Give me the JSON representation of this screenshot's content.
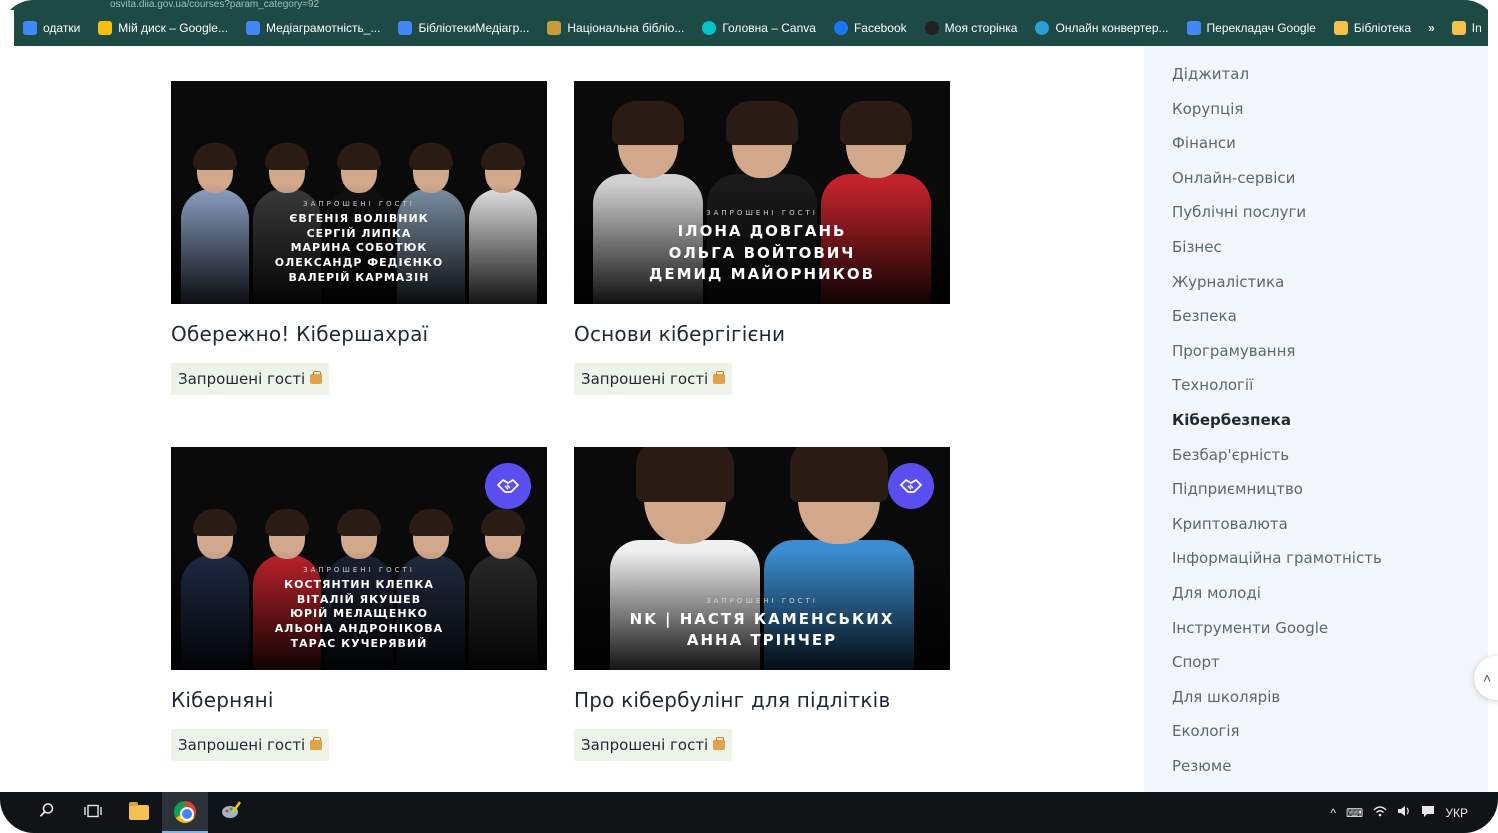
{
  "browser": {
    "address_fragment": "osvita.diia.gov.ua/courses?param_category=92",
    "bookmarks": [
      {
        "label": "одатки",
        "icon": "apps-icon",
        "color": "#4285f4"
      },
      {
        "label": "Мій диск – Google...",
        "icon": "google-drive-icon",
        "color": "#f4c20d"
      },
      {
        "label": "Медіаграмотність_...",
        "icon": "google-docs-icon",
        "color": "#4285f4"
      },
      {
        "label": "БібліотекиМедіагр...",
        "icon": "google-docs-icon",
        "color": "#4285f4"
      },
      {
        "label": "Національна бібліо...",
        "icon": "library-icon",
        "color": "#c89b3c"
      },
      {
        "label": "Головна – Canva",
        "icon": "canva-icon",
        "color": "#00c4cc"
      },
      {
        "label": "Facebook",
        "icon": "facebook-icon",
        "color": "#1877f2"
      },
      {
        "label": "Моя сторінка",
        "icon": "page-icon",
        "color": "#222222"
      },
      {
        "label": "Онлайн конвертер...",
        "icon": "converter-icon",
        "color": "#2a9fd6"
      },
      {
        "label": "Перекладач Google",
        "icon": "google-translate-icon",
        "color": "#4285f4"
      },
      {
        "label": "Бібліотека",
        "icon": "bookmark-folder-icon",
        "color": "#f2c14e"
      }
    ],
    "more_label": "»",
    "overflow_label": "In"
  },
  "courses": [
    {
      "title": "Обережно! Кібершахраї",
      "tag": "Запрошені гості",
      "guests_heading": "ЗАПРОШЕНІ ГОСТІ",
      "guests": [
        "Євгенія Волівник",
        "Сергій Липка",
        "Марина Соботюк",
        "Олександр Федієнко",
        "Валерій Кармазін"
      ],
      "has_badge": false,
      "people_colors": [
        "#8fa3c8",
        "#3b3b3b",
        "#111111",
        "#7e93a8",
        "#e6e6e6"
      ]
    },
    {
      "title": "Основи кібергігієни",
      "tag": "Запрошені гості",
      "guests_heading": "ЗАПРОШЕНІ ГОСТІ",
      "guests": [
        "Ілона Довгань",
        "Ольга Войтович",
        "Демид Майорников"
      ],
      "has_badge": false,
      "people_colors": [
        "#cfcfcf",
        "#1a1a1a",
        "#c0232b"
      ]
    },
    {
      "title": "Кіберняні",
      "tag": "Запрошені гості",
      "guests_heading": "ЗАПРОШЕНІ ГОСТІ",
      "guests": [
        "Костянтин Клепка",
        "Віталій Якушев",
        "Юрій Мелащенко",
        "Альона Андронікова",
        "Тарас Кучерявий"
      ],
      "has_badge": true,
      "people_colors": [
        "#1f2a44",
        "#c0232b",
        "#1b2233",
        "#222c3f",
        "#2a2a2a"
      ]
    },
    {
      "title": "Про кібербулінг для підлітків",
      "tag": "Запрошені гості",
      "guests_heading": "ЗАПРОШЕНІ ГОСТІ",
      "guests": [
        "NK | Настя Каменських",
        "Анна Трінчер"
      ],
      "has_badge": true,
      "people_colors": [
        "#f0f0f0",
        "#3c8ed1"
      ]
    }
  ],
  "sidebar": {
    "active": "Кібербезпека",
    "categories": [
      "Діджитал",
      "Корупція",
      "Фінанси",
      "Онлайн-сервіси",
      "Публічні послуги",
      "Бізнес",
      "Журналістика",
      "Безпека",
      "Програмування",
      "Технології",
      "Кібербезпека",
      "Безбар'єрність",
      "Підприємництво",
      "Криптовалюта",
      "Інформаційна грамотність",
      "Для молоді",
      "Інструменти Google",
      "Спорт",
      "Для школярів",
      "Екологія",
      "Резюме"
    ]
  },
  "taskbar": {
    "tray_text": "УКР",
    "tray_icons": [
      "chevron-up-icon",
      "keyboard-icon",
      "wifi-icon",
      "volume-icon",
      "notification-icon"
    ]
  },
  "colors": {
    "bookmark_bar": "#1d4a45",
    "sidebar_bg": "#f3f6fa",
    "tag_bg": "#eef3ea",
    "badge": "#5b4ef0",
    "taskbar": "#101417"
  }
}
